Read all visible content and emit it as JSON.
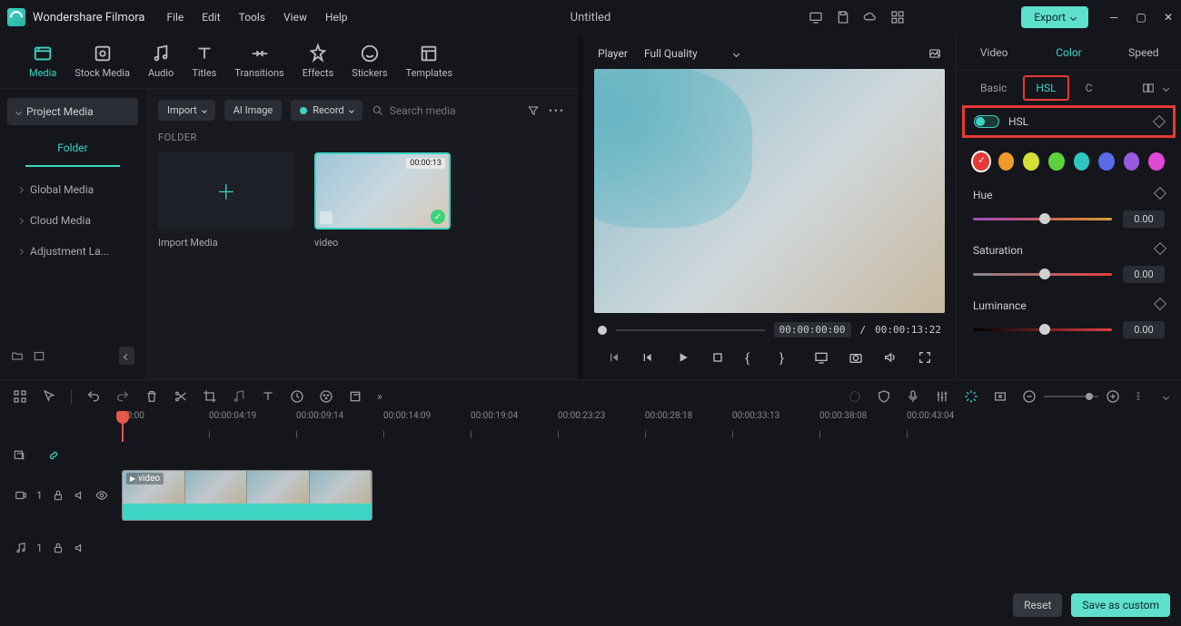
{
  "app": {
    "name": "Wondershare Filmora",
    "doc": "Untitled",
    "export": "Export"
  },
  "menu": [
    "File",
    "Edit",
    "Tools",
    "View",
    "Help"
  ],
  "media_tabs": [
    "Media",
    "Stock Media",
    "Audio",
    "Titles",
    "Transitions",
    "Effects",
    "Stickers",
    "Templates"
  ],
  "sidebar": {
    "project_media": "Project Media",
    "folder": "Folder",
    "items": [
      "Global Media",
      "Cloud Media",
      "Adjustment La..."
    ]
  },
  "content_toolbar": {
    "import": "Import",
    "ai_image": "AI Image",
    "record": "Record",
    "search_ph": "Search media"
  },
  "content": {
    "folder_label": "FOLDER",
    "import_media": "Import Media",
    "clip_name": "video",
    "clip_duration": "00:00:13"
  },
  "preview": {
    "player": "Player",
    "quality": "Full Quality",
    "tc_current": "00:00:00:00",
    "tc_total": "00:00:13:22"
  },
  "right": {
    "tabs": [
      "Video",
      "Color",
      "Speed"
    ],
    "subtabs": {
      "basic": "Basic",
      "hsl": "HSL",
      "c": "C"
    },
    "hsl_label": "HSL",
    "hue": {
      "label": "Hue",
      "value": "0.00"
    },
    "sat": {
      "label": "Saturation",
      "value": "0.00"
    },
    "lum": {
      "label": "Luminance",
      "value": "0.00"
    },
    "swatches": [
      "#e63936",
      "#ef9a2a",
      "#d4df34",
      "#5fd13e",
      "#2ec7c0",
      "#5a6be8",
      "#9a59e0",
      "#e048d4"
    ],
    "reset": "Reset",
    "save": "Save as custom"
  },
  "timeline": {
    "ticks": [
      "00:00",
      "00:00:04:19",
      "00:00:09:14",
      "00:00:14:09",
      "00:00:19:04",
      "00:00:23:23",
      "00:00:28:18",
      "00:00:33:13",
      "00:00:38:08",
      "00:00:43:04"
    ],
    "clip_name": "video",
    "video_track": "1",
    "audio_track": "1"
  }
}
